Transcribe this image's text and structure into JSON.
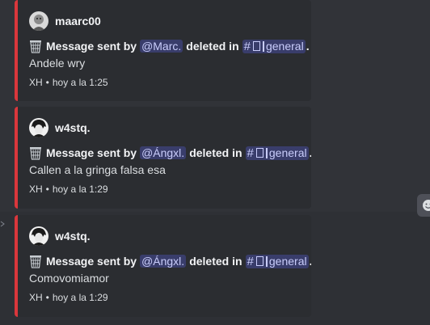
{
  "colors": {
    "background": "#313338",
    "embed_background": "#2b2d31",
    "embed_border": "#da373c",
    "mention_text": "#c9cdfb",
    "mention_background": "rgba(88,101,242,0.3)"
  },
  "messages": [
    {
      "author": "maarc00",
      "avatar_icon": "avatar-image",
      "title_prefix": "Message sent by",
      "user_mention": "@Marc.",
      "deleted_in": "deleted in",
      "channel_name": "general",
      "title_suffix": ".",
      "content": "Andele wry",
      "footer_text": "XH",
      "footer_separator": "•",
      "timestamp": "hoy a la 1:25"
    },
    {
      "author": "w4stq.",
      "avatar_icon": "avatar-image",
      "title_prefix": "Message sent by",
      "user_mention": "@Ángxl.",
      "deleted_in": "deleted in",
      "channel_name": "general",
      "title_suffix": ".",
      "content": "Callen a la gringa falsa esa",
      "footer_text": "XH",
      "footer_separator": "•",
      "timestamp": "hoy a la 1:29"
    },
    {
      "author": "w4stq.",
      "avatar_icon": "avatar-image",
      "title_prefix": "Message sent by",
      "user_mention": "@Ángxl.",
      "deleted_in": "deleted in",
      "channel_name": "general",
      "title_suffix": ".",
      "content": "Comovomiamor",
      "footer_text": "XH",
      "footer_separator": "•",
      "timestamp": "hoy a la 1:29"
    }
  ],
  "toolbar": {
    "emoji_icon": "smiley-icon"
  }
}
